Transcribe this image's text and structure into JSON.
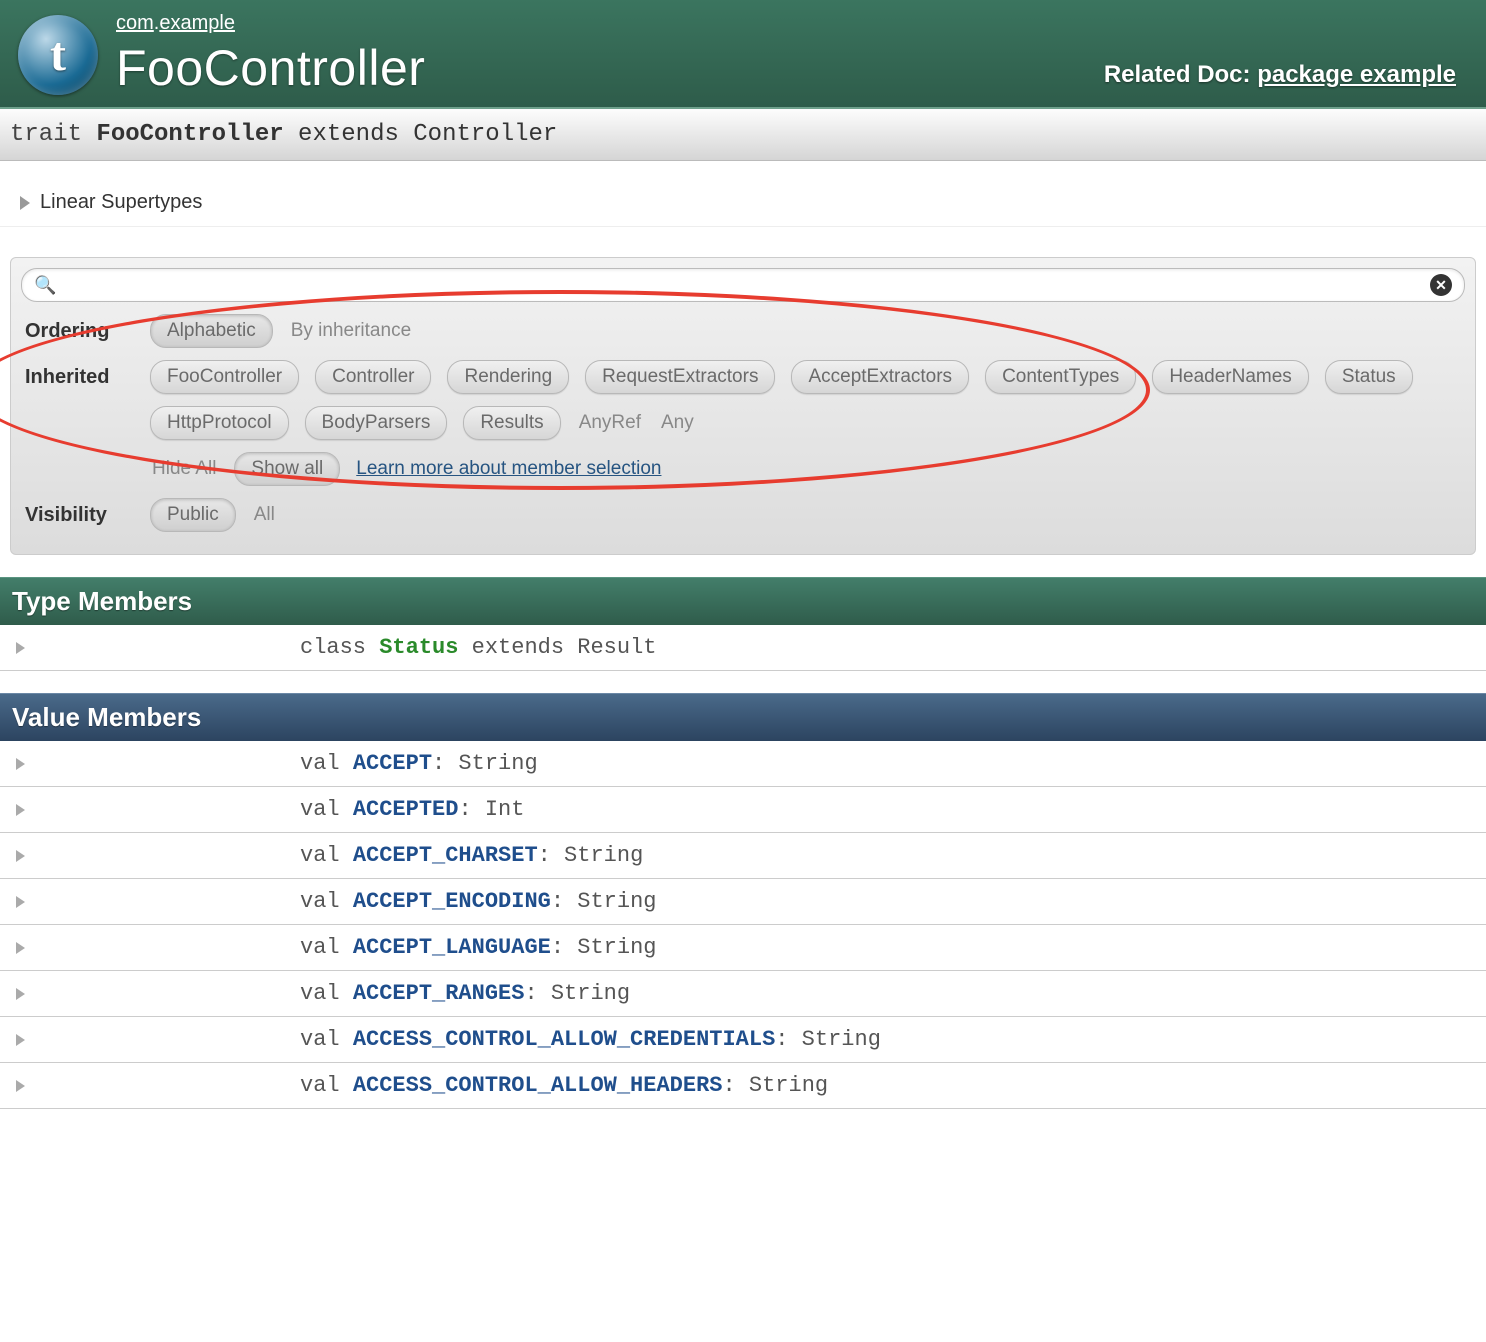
{
  "breadcrumb": {
    "pkg1": "com",
    "sep": ".",
    "pkg2": "example"
  },
  "title": "FooController",
  "related": {
    "prefix": "Related Doc: ",
    "link": "package example"
  },
  "signature": {
    "keyword": "trait ",
    "name": "FooController",
    "rest": " extends Controller"
  },
  "linear_supertypes": "Linear Supertypes",
  "filters": {
    "ordering_label": "Ordering",
    "ordering": {
      "alphabetic": "Alphabetic",
      "by_inheritance": "By inheritance"
    },
    "inherited_label": "Inherited",
    "inherited_pills": [
      "FooController",
      "Controller",
      "Rendering",
      "RequestExtractors",
      "AcceptExtractors",
      "ContentTypes",
      "HeaderNames",
      "Status",
      "HttpProtocol",
      "BodyParsers",
      "Results"
    ],
    "inherited_plain": [
      "AnyRef",
      "Any"
    ],
    "hide_all": "Hide All",
    "show_all": "Show all",
    "learn_more": "Learn more about member selection",
    "visibility_label": "Visibility",
    "visibility": {
      "public": "Public",
      "all": "All"
    }
  },
  "sections": {
    "type_members": "Type Members",
    "value_members": "Value Members"
  },
  "type_members": [
    {
      "kw": "class ",
      "name": "Status",
      "green": true,
      "rest": " extends Result"
    }
  ],
  "value_members": [
    {
      "kw": "val ",
      "name": "ACCEPT",
      "rest": ": String"
    },
    {
      "kw": "val ",
      "name": "ACCEPTED",
      "rest": ": Int"
    },
    {
      "kw": "val ",
      "name": "ACCEPT_CHARSET",
      "rest": ": String"
    },
    {
      "kw": "val ",
      "name": "ACCEPT_ENCODING",
      "rest": ": String"
    },
    {
      "kw": "val ",
      "name": "ACCEPT_LANGUAGE",
      "rest": ": String"
    },
    {
      "kw": "val ",
      "name": "ACCEPT_RANGES",
      "rest": ": String"
    },
    {
      "kw": "val ",
      "name": "ACCESS_CONTROL_ALLOW_CREDENTIALS",
      "rest": ": String"
    },
    {
      "kw": "val ",
      "name": "ACCESS_CONTROL_ALLOW_HEADERS",
      "rest": ": String"
    }
  ]
}
